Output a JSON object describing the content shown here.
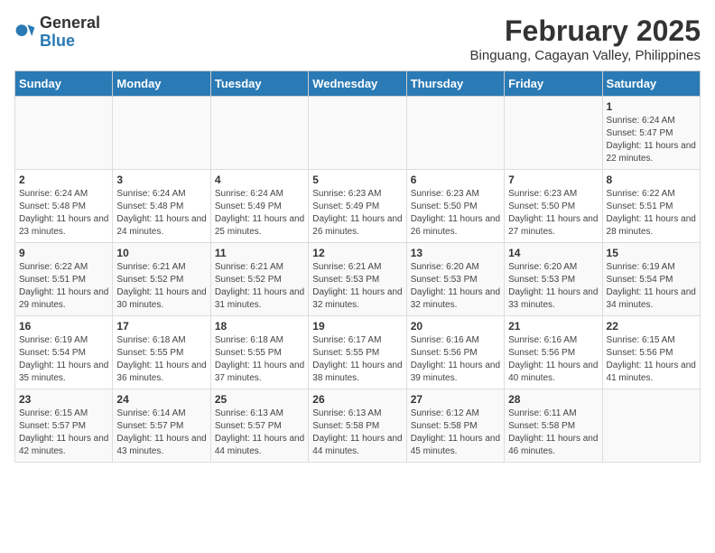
{
  "header": {
    "logo_general": "General",
    "logo_blue": "Blue",
    "title": "February 2025",
    "subtitle": "Binguang, Cagayan Valley, Philippines"
  },
  "weekdays": [
    "Sunday",
    "Monday",
    "Tuesday",
    "Wednesday",
    "Thursday",
    "Friday",
    "Saturday"
  ],
  "weeks": [
    [
      {
        "day": "",
        "sunrise": "",
        "sunset": "",
        "daylight": ""
      },
      {
        "day": "",
        "sunrise": "",
        "sunset": "",
        "daylight": ""
      },
      {
        "day": "",
        "sunrise": "",
        "sunset": "",
        "daylight": ""
      },
      {
        "day": "",
        "sunrise": "",
        "sunset": "",
        "daylight": ""
      },
      {
        "day": "",
        "sunrise": "",
        "sunset": "",
        "daylight": ""
      },
      {
        "day": "",
        "sunrise": "",
        "sunset": "",
        "daylight": ""
      },
      {
        "day": "1",
        "sunrise": "Sunrise: 6:24 AM",
        "sunset": "Sunset: 5:47 PM",
        "daylight": "Daylight: 11 hours and 22 minutes."
      }
    ],
    [
      {
        "day": "2",
        "sunrise": "Sunrise: 6:24 AM",
        "sunset": "Sunset: 5:48 PM",
        "daylight": "Daylight: 11 hours and 23 minutes."
      },
      {
        "day": "3",
        "sunrise": "Sunrise: 6:24 AM",
        "sunset": "Sunset: 5:48 PM",
        "daylight": "Daylight: 11 hours and 24 minutes."
      },
      {
        "day": "4",
        "sunrise": "Sunrise: 6:24 AM",
        "sunset": "Sunset: 5:49 PM",
        "daylight": "Daylight: 11 hours and 25 minutes."
      },
      {
        "day": "5",
        "sunrise": "Sunrise: 6:23 AM",
        "sunset": "Sunset: 5:49 PM",
        "daylight": "Daylight: 11 hours and 26 minutes."
      },
      {
        "day": "6",
        "sunrise": "Sunrise: 6:23 AM",
        "sunset": "Sunset: 5:50 PM",
        "daylight": "Daylight: 11 hours and 26 minutes."
      },
      {
        "day": "7",
        "sunrise": "Sunrise: 6:23 AM",
        "sunset": "Sunset: 5:50 PM",
        "daylight": "Daylight: 11 hours and 27 minutes."
      },
      {
        "day": "8",
        "sunrise": "Sunrise: 6:22 AM",
        "sunset": "Sunset: 5:51 PM",
        "daylight": "Daylight: 11 hours and 28 minutes."
      }
    ],
    [
      {
        "day": "9",
        "sunrise": "Sunrise: 6:22 AM",
        "sunset": "Sunset: 5:51 PM",
        "daylight": "Daylight: 11 hours and 29 minutes."
      },
      {
        "day": "10",
        "sunrise": "Sunrise: 6:21 AM",
        "sunset": "Sunset: 5:52 PM",
        "daylight": "Daylight: 11 hours and 30 minutes."
      },
      {
        "day": "11",
        "sunrise": "Sunrise: 6:21 AM",
        "sunset": "Sunset: 5:52 PM",
        "daylight": "Daylight: 11 hours and 31 minutes."
      },
      {
        "day": "12",
        "sunrise": "Sunrise: 6:21 AM",
        "sunset": "Sunset: 5:53 PM",
        "daylight": "Daylight: 11 hours and 32 minutes."
      },
      {
        "day": "13",
        "sunrise": "Sunrise: 6:20 AM",
        "sunset": "Sunset: 5:53 PM",
        "daylight": "Daylight: 11 hours and 32 minutes."
      },
      {
        "day": "14",
        "sunrise": "Sunrise: 6:20 AM",
        "sunset": "Sunset: 5:53 PM",
        "daylight": "Daylight: 11 hours and 33 minutes."
      },
      {
        "day": "15",
        "sunrise": "Sunrise: 6:19 AM",
        "sunset": "Sunset: 5:54 PM",
        "daylight": "Daylight: 11 hours and 34 minutes."
      }
    ],
    [
      {
        "day": "16",
        "sunrise": "Sunrise: 6:19 AM",
        "sunset": "Sunset: 5:54 PM",
        "daylight": "Daylight: 11 hours and 35 minutes."
      },
      {
        "day": "17",
        "sunrise": "Sunrise: 6:18 AM",
        "sunset": "Sunset: 5:55 PM",
        "daylight": "Daylight: 11 hours and 36 minutes."
      },
      {
        "day": "18",
        "sunrise": "Sunrise: 6:18 AM",
        "sunset": "Sunset: 5:55 PM",
        "daylight": "Daylight: 11 hours and 37 minutes."
      },
      {
        "day": "19",
        "sunrise": "Sunrise: 6:17 AM",
        "sunset": "Sunset: 5:55 PM",
        "daylight": "Daylight: 11 hours and 38 minutes."
      },
      {
        "day": "20",
        "sunrise": "Sunrise: 6:16 AM",
        "sunset": "Sunset: 5:56 PM",
        "daylight": "Daylight: 11 hours and 39 minutes."
      },
      {
        "day": "21",
        "sunrise": "Sunrise: 6:16 AM",
        "sunset": "Sunset: 5:56 PM",
        "daylight": "Daylight: 11 hours and 40 minutes."
      },
      {
        "day": "22",
        "sunrise": "Sunrise: 6:15 AM",
        "sunset": "Sunset: 5:56 PM",
        "daylight": "Daylight: 11 hours and 41 minutes."
      }
    ],
    [
      {
        "day": "23",
        "sunrise": "Sunrise: 6:15 AM",
        "sunset": "Sunset: 5:57 PM",
        "daylight": "Daylight: 11 hours and 42 minutes."
      },
      {
        "day": "24",
        "sunrise": "Sunrise: 6:14 AM",
        "sunset": "Sunset: 5:57 PM",
        "daylight": "Daylight: 11 hours and 43 minutes."
      },
      {
        "day": "25",
        "sunrise": "Sunrise: 6:13 AM",
        "sunset": "Sunset: 5:57 PM",
        "daylight": "Daylight: 11 hours and 44 minutes."
      },
      {
        "day": "26",
        "sunrise": "Sunrise: 6:13 AM",
        "sunset": "Sunset: 5:58 PM",
        "daylight": "Daylight: 11 hours and 44 minutes."
      },
      {
        "day": "27",
        "sunrise": "Sunrise: 6:12 AM",
        "sunset": "Sunset: 5:58 PM",
        "daylight": "Daylight: 11 hours and 45 minutes."
      },
      {
        "day": "28",
        "sunrise": "Sunrise: 6:11 AM",
        "sunset": "Sunset: 5:58 PM",
        "daylight": "Daylight: 11 hours and 46 minutes."
      },
      {
        "day": "",
        "sunrise": "",
        "sunset": "",
        "daylight": ""
      }
    ]
  ]
}
